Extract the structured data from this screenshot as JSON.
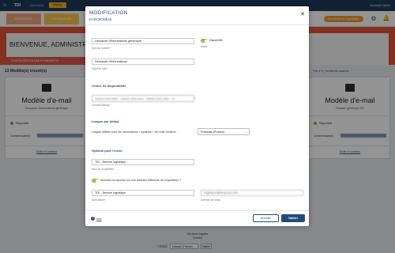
{
  "topbar": {
    "brand": "TDI",
    "user": "username",
    "env_badge": "Staging • V7.7.0",
    "account": "Account name"
  },
  "nav": {
    "tab_a": "EXPEDITIO",
    "tab_b": "EXTRACLUB",
    "right_badge": "Nouveautés de l'application"
  },
  "banner": {
    "title": "BIENVENUE, ADMINISTRATEUR",
    "subtitle": "CONFIGURATION DES ÉVÉNEMENTS"
  },
  "list": {
    "count": "13 Modèle(s) trouvé(s)",
    "right_tools": "Trier ▾  🔍 Recherche avancée"
  },
  "cards": {
    "left": {
      "title": "Modèle d'e-mail",
      "subtitle": "Demande d'informations générique",
      "status": "Disponible",
      "commercial_label": "Commerciale(s) :",
      "edit_link": "Editer le contenu"
    },
    "right": {
      "title": "Modèle d'e-mail",
      "subtitle": "Relance générique EN",
      "status": "Disponible",
      "commercial_label": "Commerciale(s) :",
      "edit_link": "Editer le contenu"
    }
  },
  "modal": {
    "title": "MODIFICATION",
    "subtitle": "D'UN MODÈLE",
    "name_value": "Demande d'informations générique",
    "name_hint": "Nom du modèle *",
    "dispo_label": "Disponible",
    "dispo_hint": "Statut",
    "subject_value": "Demande d'informations",
    "subject_hint": "Objet du mail *",
    "section_criteria": "Critère de disponibilité",
    "commercial_value": "xxxxxx-xxxx-xxxx · xxxxxx-xxxx-xxxx · xxxxxx-xxxx-xxxx · xx",
    "commercial_hint": "Commerciale(s) *",
    "section_lang": "Langue par défaut",
    "lang_desc": "Langue utilisée pour les informations « système » de votre contenu",
    "lang_value": "Français (France)",
    "section_send": "Options pour l'envoi",
    "sender_value": "TDI - Service logistique",
    "sender_hint": "Nom de l'expéditeur",
    "reply_toggle_label": "Autoriser la réponse sur une adresse différente de l'expéditeur ?",
    "reply_name_value": "TDI - Service logistique",
    "reply_name_hint": "Nom affiché",
    "reply_email_value": "logistique@tdi-group.com",
    "reply_email_hint": "Adresse de retour",
    "help_label": "Aide",
    "cancel_label": "Annuler",
    "save_label": "Valider"
  },
  "footer": {
    "legal": "Mentions légales",
    "contact": "Contact",
    "lang_label": "Langue",
    "lang_value": "français (France)",
    "lang_btn": "Valider"
  }
}
